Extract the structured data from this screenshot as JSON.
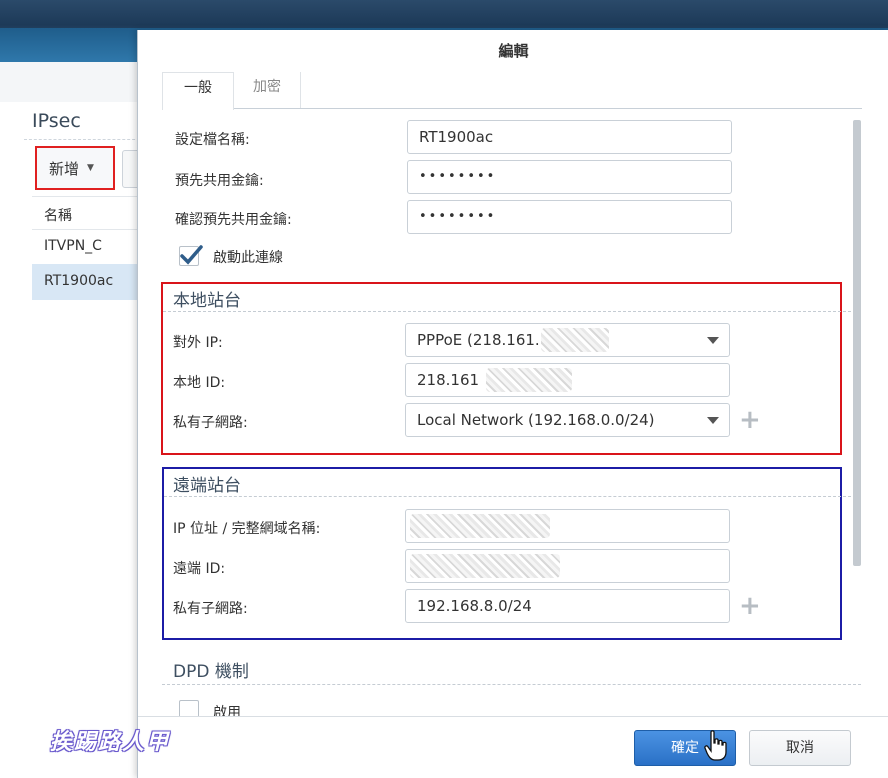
{
  "background": {
    "title": "IPsec",
    "add_label": "新增",
    "column_header": "名稱",
    "rows": [
      "ITVPN_C",
      "RT1900ac"
    ]
  },
  "dialog": {
    "title": "編輯",
    "tabs": [
      "一般",
      "加密"
    ],
    "profile_name_label": "設定檔名稱:",
    "profile_name_value": "RT1900ac",
    "psk_label": "預先共用金鑰:",
    "psk_value": "••••••••",
    "psk_confirm_label": "確認預先共用金鑰:",
    "psk_confirm_value": "••••••••",
    "enable_label": "啟動此連線",
    "enable_checked": true,
    "local": {
      "title": "本地站台",
      "external_ip_label": "對外 IP:",
      "external_ip_value": "PPPoE (218.161.",
      "local_id_label": "本地 ID:",
      "local_id_value": "218.161",
      "private_subnet_label": "私有子網路:",
      "private_subnet_value": "Local Network (192.168.0.0/24)"
    },
    "remote": {
      "title": "遠端站台",
      "ip_label": "IP 位址 / 完整網域名稱:",
      "remote_id_label": "遠端 ID:",
      "private_subnet_label": "私有子網路:",
      "private_subnet_value": "192.168.8.0/24"
    },
    "dpd": {
      "title": "DPD 機制",
      "enable_label": "啟用"
    },
    "ok_label": "確定",
    "cancel_label": "取消"
  },
  "watermark": "挨踢路人甲",
  "colors": {
    "primary": "#2a70c6",
    "highlight_red": "#d9141a",
    "highlight_blue": "#1c1ca6",
    "selected_row": "#d8e7f5"
  }
}
